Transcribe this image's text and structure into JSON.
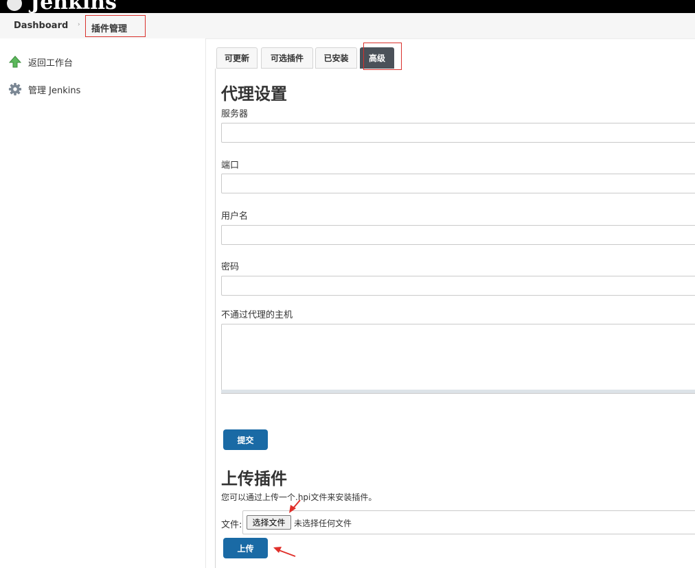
{
  "app": {
    "logo_text": "Jenkins"
  },
  "breadcrumb": {
    "home": "Dashboard",
    "separator": "›",
    "current": "插件管理"
  },
  "sidebar": {
    "items": [
      {
        "label": "返回工作台",
        "icon": "arrow-up-icon"
      },
      {
        "label": "管理 Jenkins",
        "icon": "gear-icon"
      }
    ]
  },
  "tabs": [
    {
      "label": "可更新"
    },
    {
      "label": "可选插件"
    },
    {
      "label": "已安装"
    },
    {
      "label": "高级",
      "active": true
    }
  ],
  "proxy": {
    "title": "代理设置",
    "fields": {
      "server": {
        "label": "服务器",
        "value": ""
      },
      "port": {
        "label": "端口",
        "value": ""
      },
      "username": {
        "label": "用户名",
        "value": ""
      },
      "password": {
        "label": "密码",
        "value": ""
      },
      "no_proxy_hosts": {
        "label": "不通过代理的主机",
        "value": ""
      }
    },
    "submit_label": "提交"
  },
  "upload": {
    "title": "上传插件",
    "description": "您可以通过上传一个.hpi文件来安装插件。",
    "file_label": "文件:",
    "choose_button": "选择文件",
    "no_file_text": "未选择任何文件",
    "upload_label": "上传"
  },
  "colors": {
    "accent_button": "#1a6aa5",
    "active_tab": "#4b5159",
    "annotation_red": "#e0302b"
  }
}
